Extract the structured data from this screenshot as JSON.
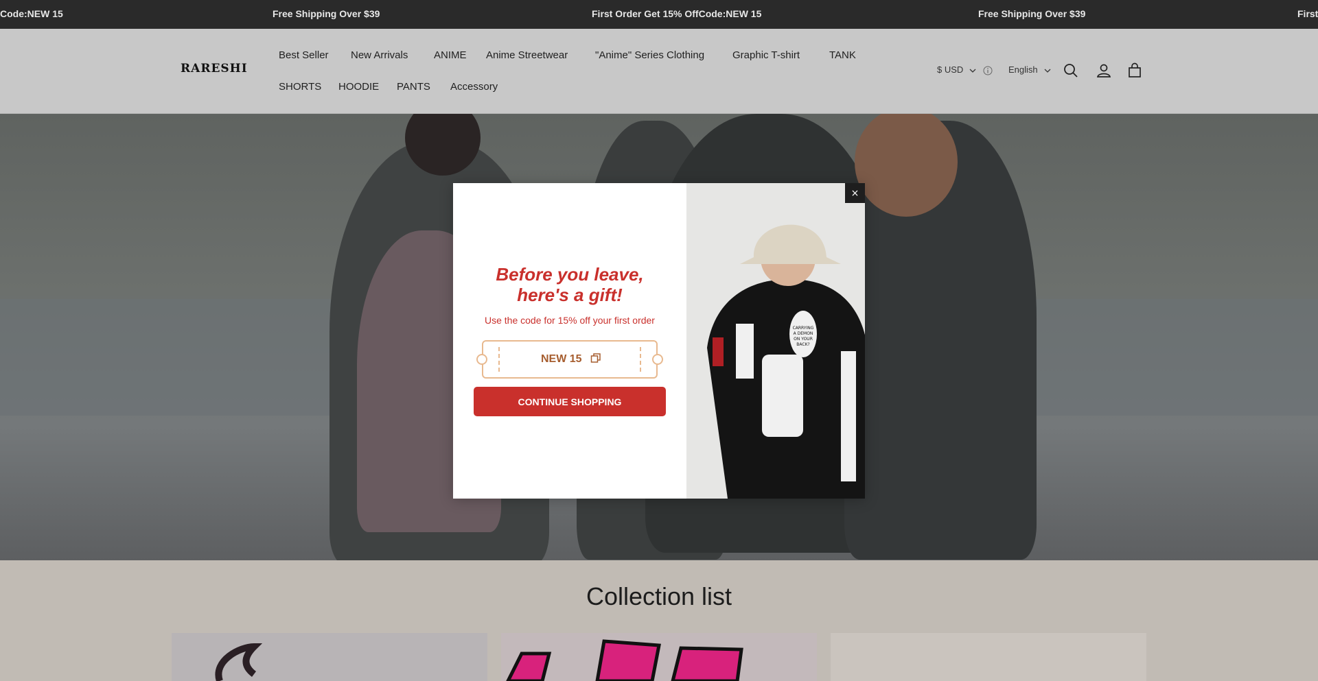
{
  "announcement": {
    "items": [
      "Code:NEW 15​",
      "Free Shipping Over $39",
      "First Order Get 15% Off​Code:NEW 15​",
      "Free Shipping Over $39",
      "First"
    ]
  },
  "header": {
    "logo": "RARESHI",
    "nav": [
      "Best Seller",
      "New Arrivals",
      "ANIME",
      "Anime Streetwear",
      "\"Anime\" Series Clothing",
      "Graphic T-shirt",
      "TANK",
      "SHORTS",
      "HOODIE",
      "PANTS",
      "Accessory"
    ],
    "currency": "$ USD",
    "language": "English"
  },
  "popup": {
    "headline_line1": "Before you leave,",
    "headline_line2": "here's a gift!",
    "subline": "Use the code for 15% off your first order",
    "code": "NEW 15",
    "button": "CONTINUE SHOPPING",
    "close": "×",
    "product_image": {
      "balloon_text": "CARRYING A DEMON ON YOUR BACK?"
    }
  },
  "collection": {
    "title": "Collection list"
  },
  "colors": {
    "accent": "#c9302c",
    "coupon_border": "#e8b98f",
    "announce_bg": "#2a2a2a"
  }
}
